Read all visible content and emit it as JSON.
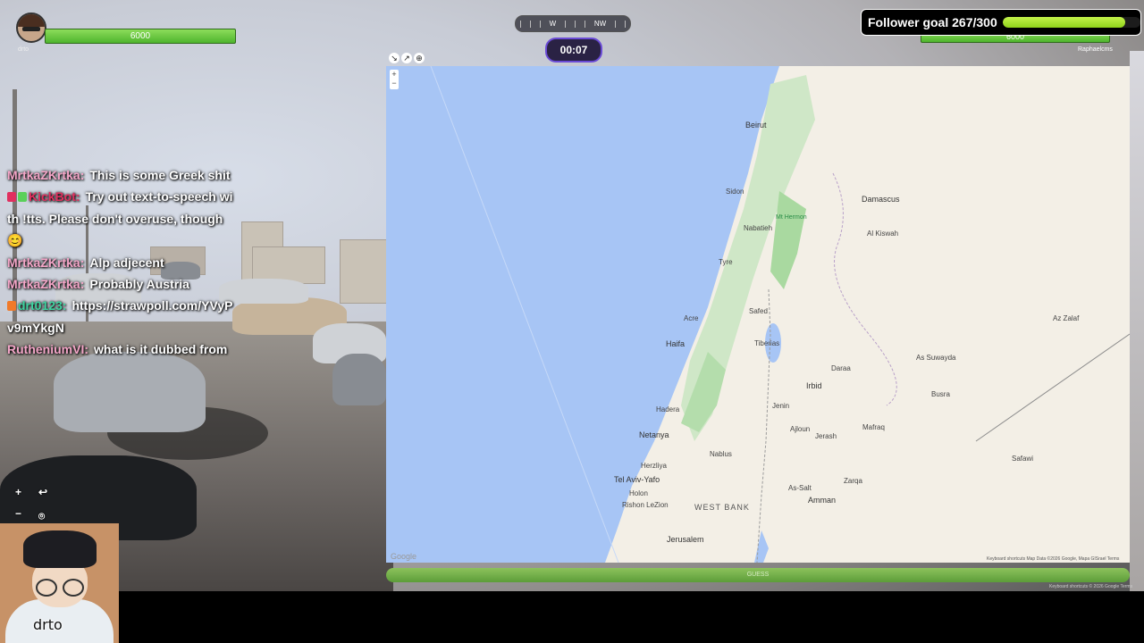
{
  "players": {
    "left": {
      "name": "drto",
      "hp": "6000"
    },
    "right": {
      "name": "Raphaelcms",
      "hp": "6000"
    }
  },
  "compass": {
    "labels": [
      "W",
      "NW"
    ]
  },
  "timer": "00:07",
  "follower_goal": {
    "label": "Follower goal 267/300",
    "current": 267,
    "target": 300
  },
  "chat": [
    {
      "user": "MrtkaZKrtka:",
      "user_color": "#f4a6c8",
      "message": "This is some Greek shit"
    },
    {
      "user": "KickBot:",
      "user_color": "#e0305f",
      "message": "Try out text-to-speech with !tts. Please don't overuse, though 😊",
      "badges": [
        "#e0305f",
        "#5ad05a"
      ]
    },
    {
      "user": "MrtkaZKrtka:",
      "user_color": "#f4a6c8",
      "message": "Alp adjecent"
    },
    {
      "user": "MrtkaZKrtka:",
      "user_color": "#f4a6c8",
      "message": "Probably Austria"
    },
    {
      "user": "drt0123:",
      "user_color": "#3fd3a0",
      "message": "https://strawpoll.com/YVyPv9mYkgN",
      "badges": [
        "#f07a2a"
      ]
    },
    {
      "user": "RutheniumVI:",
      "user_color": "#f4a6c8",
      "message": "what is it dubbed from"
    }
  ],
  "map": {
    "labels": {
      "beirut": "Beirut",
      "damascus": "Damascus",
      "haifa": "Haifa",
      "netanya": "Netanya",
      "tel_aviv": "Tel Aviv-Yafo",
      "amman": "Amman",
      "jerusalem": "Jerusalem",
      "west_bank": "WEST BANK",
      "irbid": "Irbid",
      "zarqa": "Zarqa",
      "mt_hermon": "Mt Hermon",
      "holon": "Holon",
      "rishon": "Rishon LeZion",
      "herzliya": "Herzliya",
      "tiberias": "Tiberias",
      "safed": "Safed",
      "nablus": "Nablus",
      "as_suwayda": "As Suwayda",
      "daraa": "Daraa",
      "mafraq": "Mafraq",
      "salt": "As-Salt",
      "nabatieh": "Nabatieh",
      "tyre": "Tyre",
      "sidon": "Sidon",
      "acre": "Acre",
      "hadera": "Hadera",
      "al_kiswah": "Al Kiswah",
      "busra": "Busra",
      "az_zalaf": "Az Zalaf",
      "jenin": "Jenin",
      "ajloun": "Ajloun",
      "jerash": "Jerash",
      "safawi": "Safawi"
    },
    "google": "Google",
    "attribution": "Keyboard shortcuts    Map Data ©2026 Google, Mapa GISrael    Terms"
  },
  "guess_button": "GUESS",
  "controls": {
    "zoom_in": "+",
    "undo": "↩",
    "zoom_out": "−",
    "pin": "⌾"
  },
  "webcam": {
    "name": "drto"
  },
  "bottom_attrib": "Keyboard shortcuts  © 2026 Google  Terms"
}
